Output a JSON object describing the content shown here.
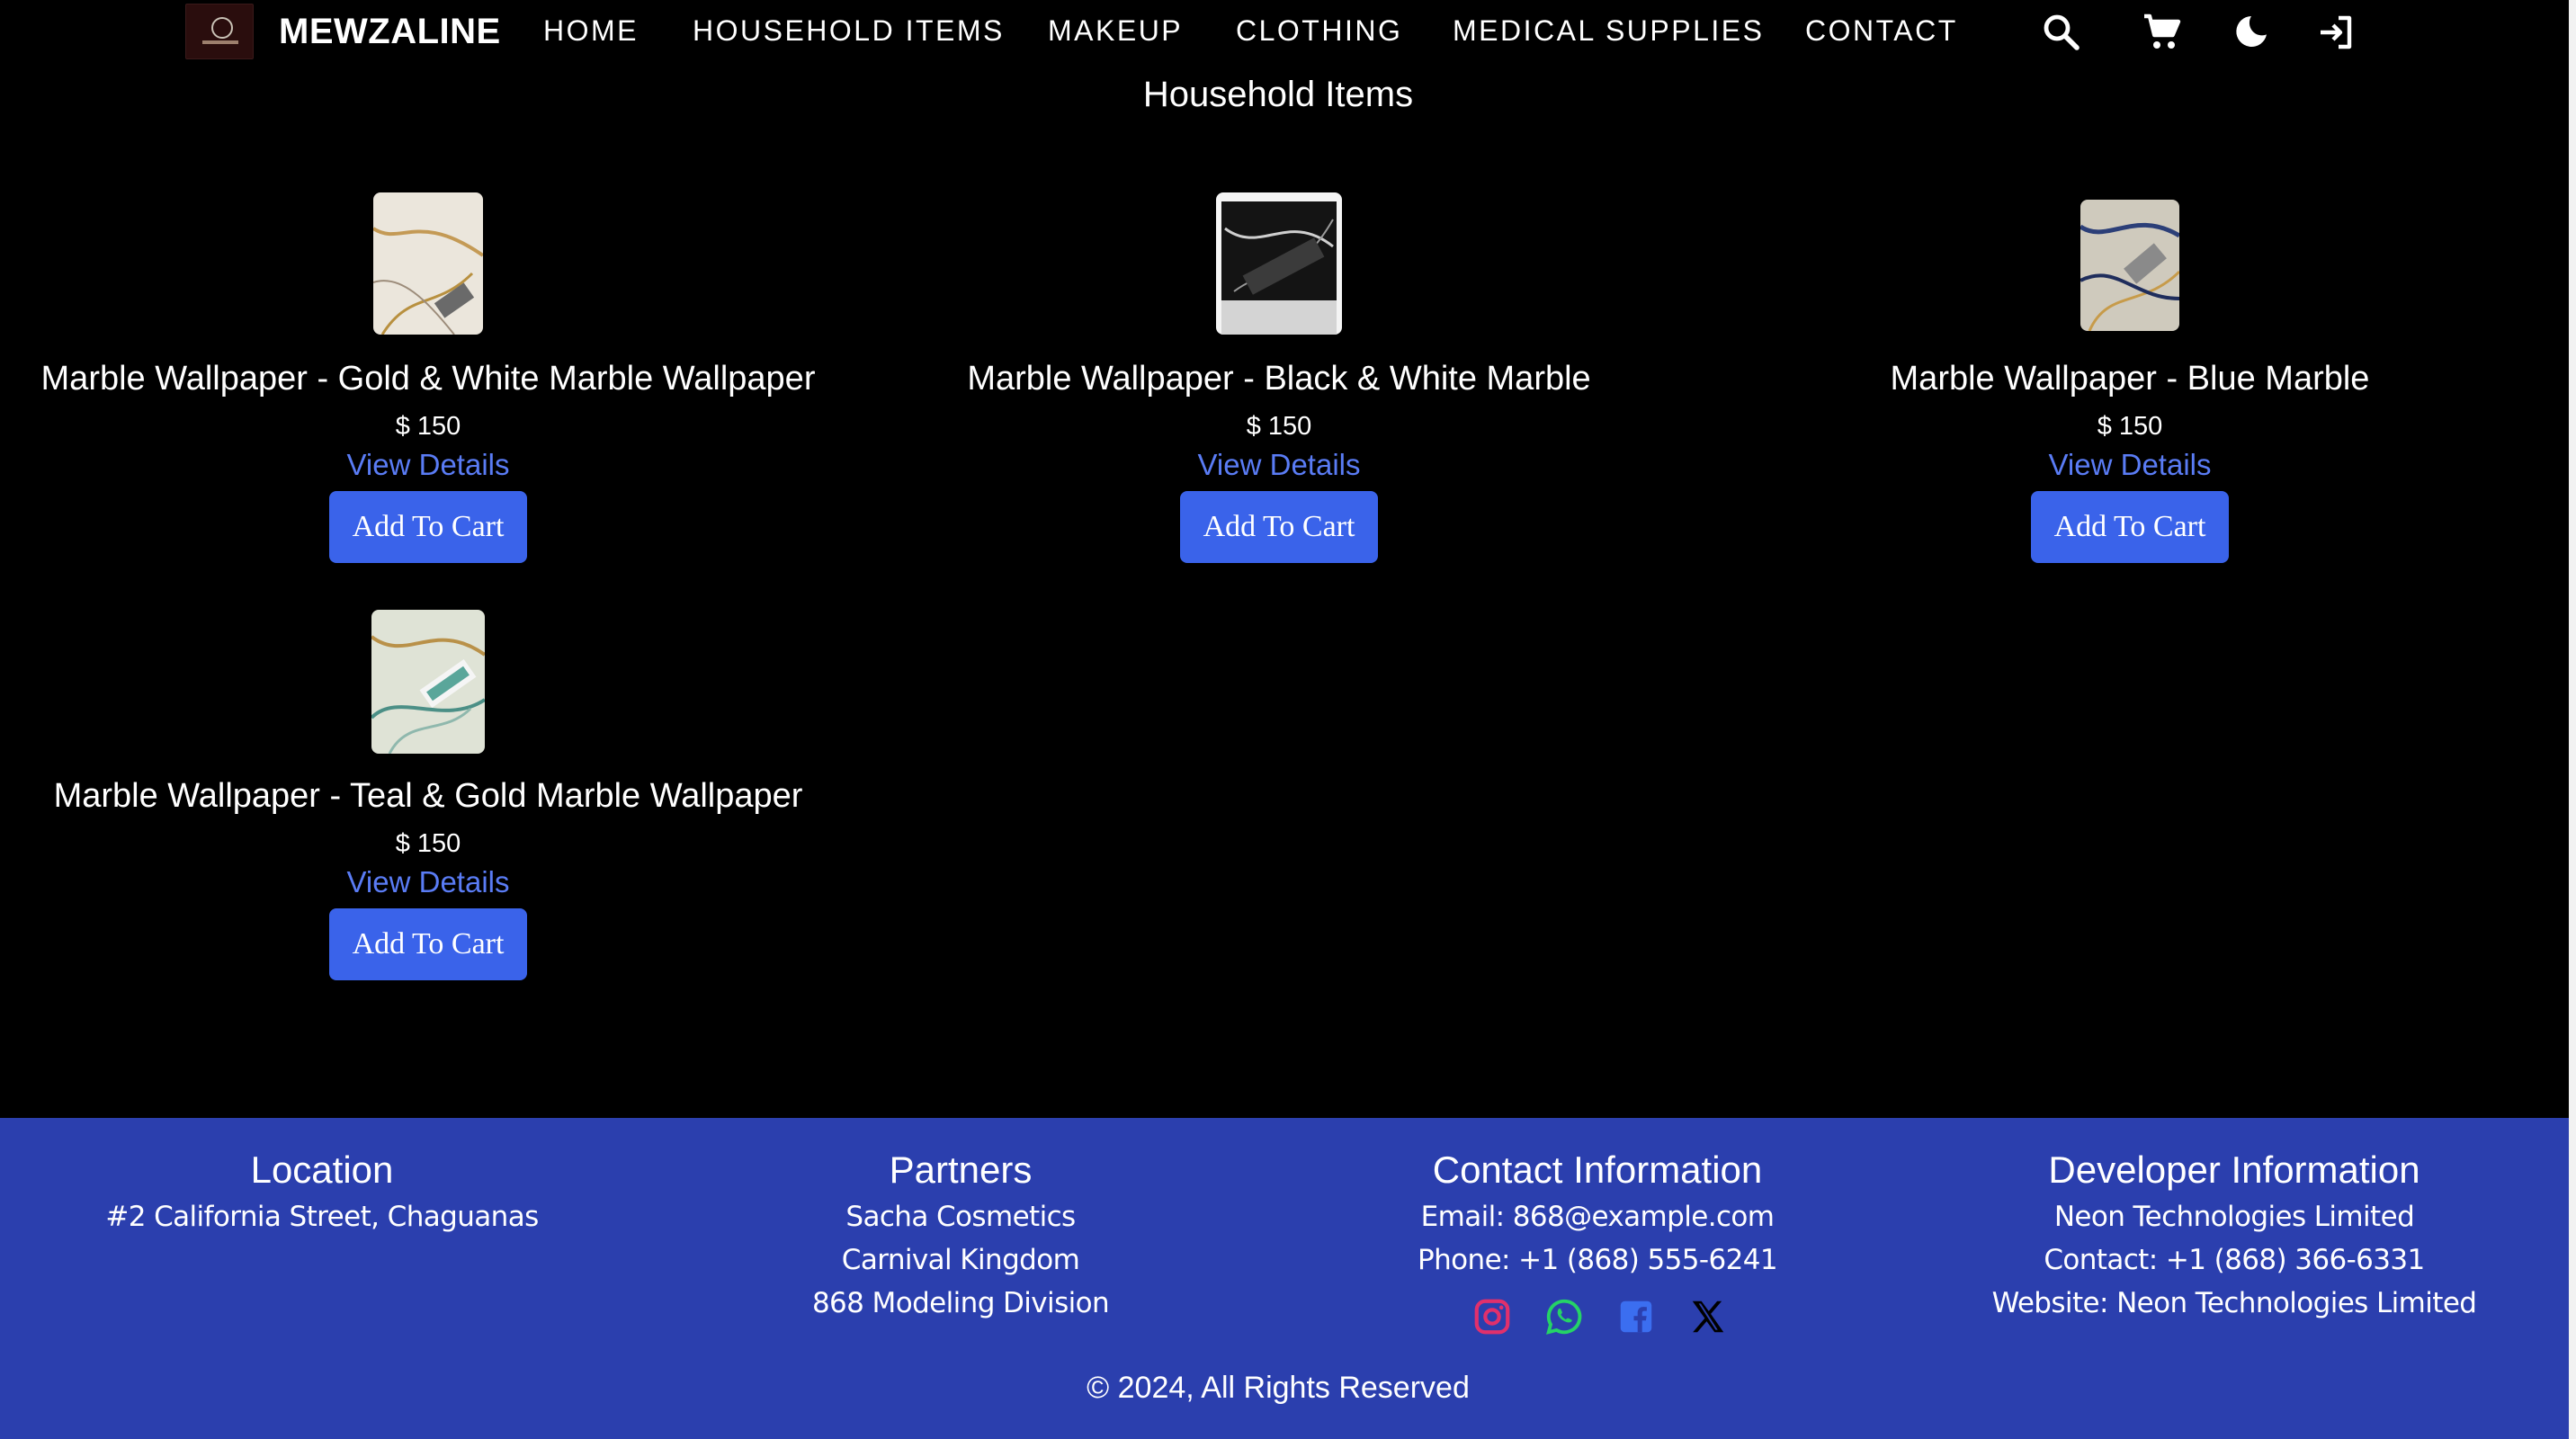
{
  "nav": {
    "brand": "MEWZALINE",
    "links": [
      "HOME",
      "HOUSEHOLD ITEMS",
      "MAKEUP",
      "CLOTHING",
      "MEDICAL SUPPLIES",
      "CONTACT"
    ],
    "icons": [
      "search-icon",
      "cart-icon",
      "dark-mode-icon",
      "login-icon"
    ]
  },
  "page": {
    "title": "Household Items"
  },
  "products": [
    {
      "name": "Marble Wallpaper - Gold & White Marble Wallpaper",
      "price": "$ 150",
      "details_label": "View Details",
      "button_label": "Add To Cart",
      "swatch": "#e9e3d8"
    },
    {
      "name": "Marble Wallpaper - Black & White Marble",
      "price": "$ 150",
      "details_label": "View Details",
      "button_label": "Add To Cart",
      "swatch": "#1a1a1a"
    },
    {
      "name": "Marble Wallpaper - Blue Marble",
      "price": "$ 150",
      "details_label": "View Details",
      "button_label": "Add To Cart",
      "swatch": "#c8c4b8"
    },
    {
      "name": "Marble Wallpaper - Teal & Gold Marble Wallpaper",
      "price": "$ 150",
      "details_label": "View Details",
      "button_label": "Add To Cart",
      "swatch": "#d9dccf"
    }
  ],
  "footer": {
    "location": {
      "heading": "Location",
      "lines": [
        "#2 California Street, Chaguanas"
      ]
    },
    "partners": {
      "heading": "Partners",
      "lines": [
        "Sacha Cosmetics",
        "Carnival Kingdom",
        "868 Modeling Division"
      ]
    },
    "contact": {
      "heading": "Contact Information",
      "lines": [
        "Email: 868@example.com",
        "Phone: +1 (868) 555-6241"
      ]
    },
    "developer": {
      "heading": "Developer Information",
      "lines": [
        "Neon Technologies Limited",
        "Contact: +1 (868) 366-6331",
        "Website: Neon Technologies Limited"
      ]
    },
    "socials": [
      "instagram-icon",
      "whatsapp-icon",
      "facebook-icon",
      "x-icon"
    ],
    "copyright": "© 2024, All Rights Reserved"
  },
  "colors": {
    "background": "#000000",
    "footer": "#2b3fae",
    "button": "#3a63ea",
    "link": "#5a7cf5",
    "instagram": "#e1306c",
    "whatsapp": "#25d366",
    "facebook": "#3b6ef0"
  }
}
